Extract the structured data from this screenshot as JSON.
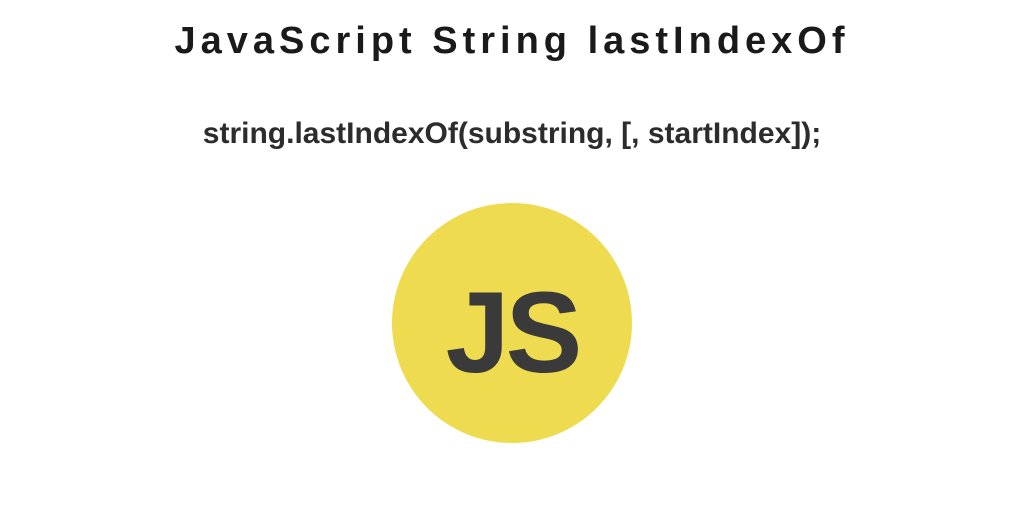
{
  "title": "JavaScript String lastIndexOf",
  "syntax": "string.lastIndexOf(substring, [, startIndex]);",
  "logo": {
    "text": "JS",
    "bgColor": "#efdb50",
    "textColor": "#3a3a3a"
  }
}
